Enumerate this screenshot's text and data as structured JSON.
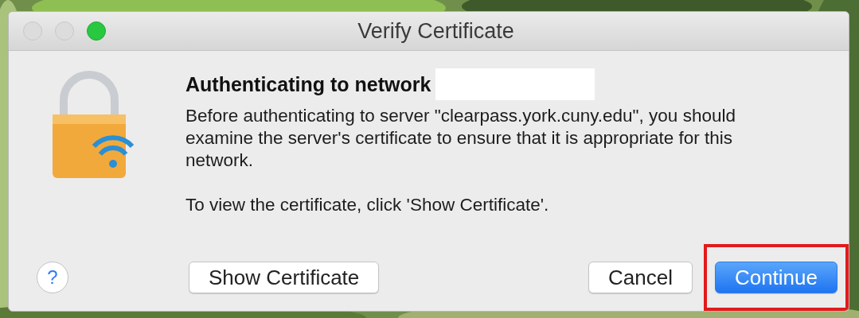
{
  "window": {
    "title": "Verify Certificate",
    "traffic_lights": [
      {
        "kind": "close",
        "enabled": false
      },
      {
        "kind": "minimize",
        "enabled": false
      },
      {
        "kind": "zoom",
        "enabled": true
      }
    ]
  },
  "heading": "Authenticating to network",
  "network_name_redacted": true,
  "paragraphs": [
    "Before authenticating to server \"clearpass.york.cuny.edu\", you should examine the server's certificate to ensure that it is appropriate for this network.",
    "To view the certificate, click 'Show Certificate'."
  ],
  "help_button": {
    "label": "?"
  },
  "buttons": [
    {
      "label": "Show Certificate",
      "kind": "default",
      "highlighted": false
    },
    {
      "label": "Cancel",
      "kind": "default",
      "highlighted": false
    },
    {
      "label": "Continue",
      "kind": "primary",
      "highlighted": true
    }
  ]
}
